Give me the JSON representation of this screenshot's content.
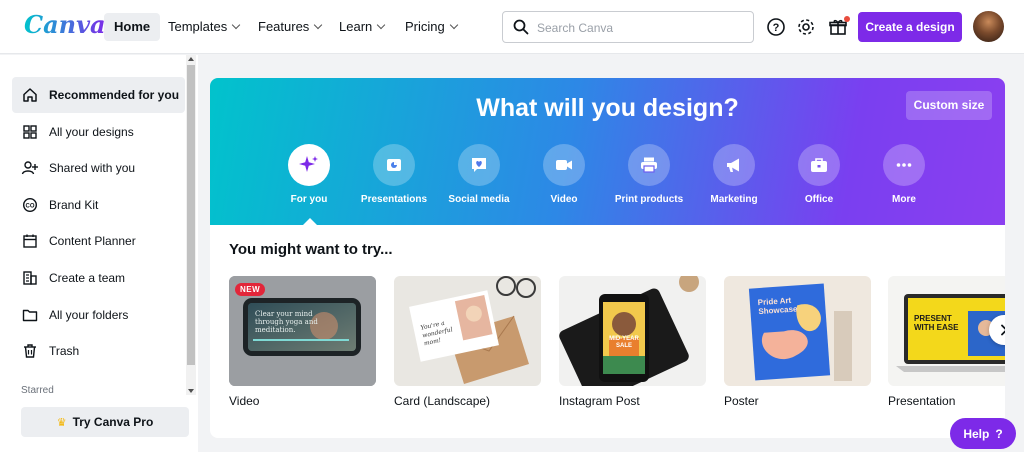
{
  "app": {
    "logo_text": "Canva"
  },
  "nav": {
    "home": "Home",
    "templates": "Templates",
    "features": "Features",
    "learn": "Learn",
    "pricing": "Pricing"
  },
  "search": {
    "placeholder": "Search Canva",
    "value": ""
  },
  "header": {
    "create_label": "Create a design"
  },
  "sidebar": {
    "items": [
      {
        "label": "Recommended for you",
        "icon": "home-icon"
      },
      {
        "label": "All your designs",
        "icon": "grid-icon"
      },
      {
        "label": "Shared with you",
        "icon": "people-icon"
      },
      {
        "label": "Brand Kit",
        "icon": "brand-kit-icon"
      },
      {
        "label": "Content Planner",
        "icon": "calendar-icon"
      },
      {
        "label": "Create a team",
        "icon": "team-icon"
      },
      {
        "label": "All your folders",
        "icon": "folder-icon"
      },
      {
        "label": "Trash",
        "icon": "trash-icon"
      }
    ],
    "starred_label": "Starred",
    "try_pro_label": "Try Canva Pro"
  },
  "hero": {
    "title": "What will you design?",
    "custom_size_label": "Custom size",
    "categories": [
      {
        "label": "For you",
        "icon": "sparkle-icon"
      },
      {
        "label": "Presentations",
        "icon": "presentation-icon"
      },
      {
        "label": "Social media",
        "icon": "heart-chat-icon"
      },
      {
        "label": "Video",
        "icon": "video-camera-icon"
      },
      {
        "label": "Print products",
        "icon": "printer-icon"
      },
      {
        "label": "Marketing",
        "icon": "megaphone-icon"
      },
      {
        "label": "Office",
        "icon": "briefcase-icon"
      },
      {
        "label": "More",
        "icon": "more-icon"
      }
    ]
  },
  "suggestions": {
    "title": "You might want to try...",
    "new_badge": "NEW",
    "video_thumb_text": "Clear your mind through yoga and meditation.",
    "card_thumb_text": "You're a wonderful mom!",
    "instagram_thumb_text": "MID-YEAR SALE",
    "poster_thumb_text": "Pride Art Showcase",
    "presentation_thumb_text": "PRESENT WITH EASE",
    "cards": [
      {
        "label": "Video"
      },
      {
        "label": "Card (Landscape)"
      },
      {
        "label": "Instagram Post"
      },
      {
        "label": "Poster"
      },
      {
        "label": "Presentation"
      }
    ]
  },
  "help": {
    "label": "Help",
    "icon_text": "?"
  },
  "colors": {
    "brand_purple": "#7d2ae8",
    "brand_teal": "#00c4cc"
  }
}
